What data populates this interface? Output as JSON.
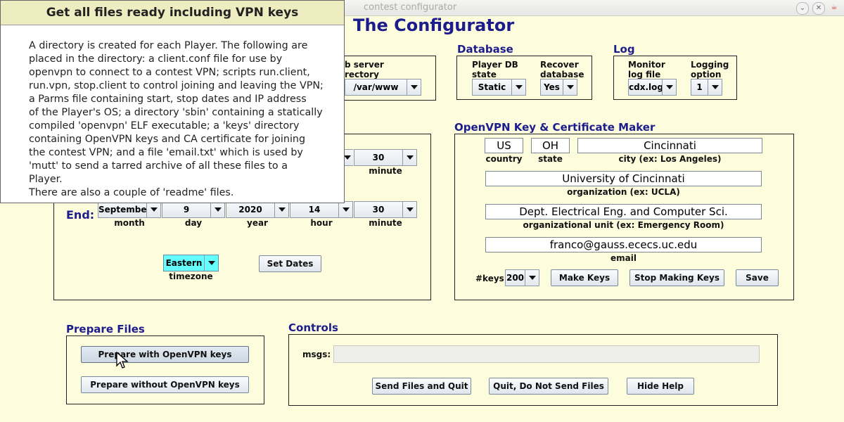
{
  "window": {
    "title": "contest configurator"
  },
  "app": {
    "title": "The Configurator"
  },
  "webserver": {
    "label_line1": "b server",
    "label_line2": "rectory",
    "value": "/var/www"
  },
  "database": {
    "title": "Database",
    "state_label_1": "Player DB",
    "state_label_2": "state",
    "state_value": "Static",
    "recover_label_1": "Recover",
    "recover_label_2": "database",
    "recover_value": "Yes"
  },
  "log": {
    "title": "Log",
    "file_label_1": "Monitor",
    "file_label_2": "log file",
    "file_value": "cdx.log",
    "option_label_1": "Logging",
    "option_label_2": "option",
    "option_value": "1"
  },
  "dates": {
    "start_minute": "30",
    "start_minute_label": "minute",
    "end_label": "End:",
    "end": {
      "month": "September",
      "day": "9",
      "year": "2020",
      "hour": "14",
      "minute": "30"
    },
    "labels": {
      "month": "month",
      "day": "day",
      "year": "year",
      "hour": "hour",
      "minute": "minute"
    },
    "timezone_value": "Eastern",
    "timezone_label": "timezone",
    "set_dates": "Set Dates"
  },
  "openvpn": {
    "title": "OpenVPN Key & Certificate Maker",
    "country": "US",
    "country_label": "country",
    "state": "OH",
    "state_label": "state",
    "city": "Cincinnati",
    "city_label": "city (ex: Los Angeles)",
    "organization": "University of Cincinnati",
    "organization_label": "organization (ex: UCLA)",
    "org_unit": "Dept. Electrical Eng. and Computer Sci.",
    "org_unit_label": "organizational unit (ex: Emergency Room)",
    "email": "franco@gauss.ececs.uc.edu",
    "email_label": "email",
    "keys_label": "#keys:",
    "keys_value": "200",
    "make_keys": "Make Keys",
    "stop_making_keys": "Stop Making Keys",
    "save": "Save"
  },
  "prepare": {
    "title": "Prepare Files",
    "with_keys": "Prepare with OpenVPN keys",
    "without_keys": "Prepare without OpenVPN keys"
  },
  "controls": {
    "title": "Controls",
    "msgs_label": "msgs:",
    "msgs_value": "",
    "send_quit": "Send Files and Quit",
    "quit_nosend": "Quit, Do Not Send Files",
    "hide_help": "Hide Help"
  },
  "help": {
    "title": "Get all files ready including VPN keys",
    "lines": [
      "A directory is created for each Player.  The following are",
      "placed in the directory: a client.conf file for use by",
      "openvpn to connect to a contest VPN; scripts run.client,",
      "run.vpn, stop.client to control joining and leaving the VPN;",
      "a Parms file containing start, stop dates and IP address",
      "of the Player's OS; a directory 'sbin' containing a statically",
      "compiled 'openvpn' ELF executable; a 'keys' directory",
      "containing OpenVPN keys and CA certificate for joining",
      "the contest VPN; and a file 'email.txt' which is used by",
      "'mutt' to send a tarred archive of all these files to a Player.",
      "There are also a couple of 'readme' files."
    ]
  },
  "colors": {
    "background": "#fdfdde",
    "section_title": "#1c1c8c",
    "timezone_highlight": "#66ffff"
  }
}
